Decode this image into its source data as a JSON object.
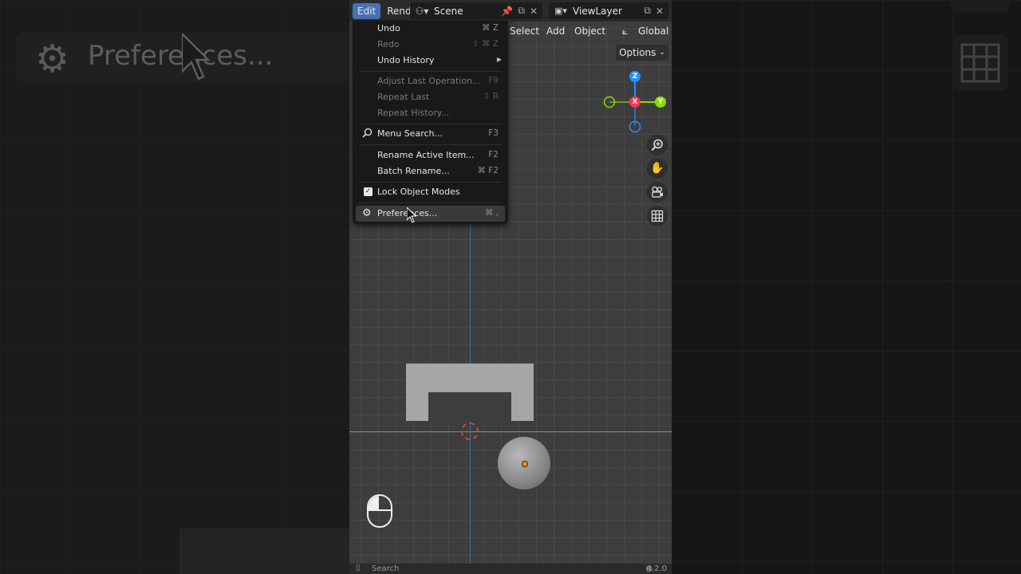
{
  "backdrop": {
    "zoomed_text": "Preferences...",
    "accent": "#161616"
  },
  "topbar": {
    "menus": [
      "Edit",
      "Rend"
    ],
    "scene_name": "Scene",
    "view_layer_name": "ViewLayer",
    "active_menu": "Edit",
    "active_color": "#4772b3"
  },
  "viewport_header": {
    "select": "Select",
    "add": "Add",
    "object": "Object",
    "transform_orientation": "Global",
    "options": "Options"
  },
  "gizmo": {
    "z": "Z",
    "x": "X",
    "y": "Y",
    "colors": {
      "x": "#ff3352",
      "y": "#8bdc00",
      "z": "#2890ff"
    }
  },
  "nav_buttons": [
    "zoom-icon",
    "pan-hand-icon",
    "camera-icon",
    "grid-icon"
  ],
  "edit_menu": {
    "items": [
      {
        "label": "Undo",
        "shortcut": "⌘ Z",
        "disabled": false
      },
      {
        "label": "Redo",
        "shortcut": "⇧ ⌘ Z",
        "disabled": true
      },
      {
        "label": "Undo History",
        "shortcut": "",
        "disabled": false,
        "submenu": true
      },
      {
        "label": "Adjust Last Operation...",
        "shortcut": "F9",
        "disabled": true
      },
      {
        "label": "Repeat Last",
        "shortcut": "⇧ R",
        "disabled": true
      },
      {
        "label": "Repeat History...",
        "shortcut": "",
        "disabled": true
      },
      {
        "label": "Menu Search...",
        "shortcut": "F3",
        "disabled": false,
        "icon": "search-icon"
      },
      {
        "label": "Rename Active Item...",
        "shortcut": "F2",
        "disabled": false
      },
      {
        "label": "Batch Rename...",
        "shortcut": "⌘ F2",
        "disabled": false
      },
      {
        "label": "Lock Object Modes",
        "shortcut": "",
        "disabled": false,
        "checked": true
      },
      {
        "label": "Preferences...",
        "shortcut": "⌘ ,",
        "disabled": false,
        "icon": "gear-icon",
        "highlighted": true
      }
    ]
  },
  "statusbar": {
    "search": "Search",
    "version": "4.2.0"
  }
}
